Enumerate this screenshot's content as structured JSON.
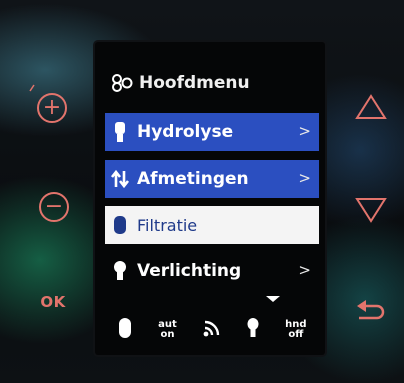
{
  "hardware": {
    "plus_label": "+",
    "minus_label": "−",
    "ok_label": "OK",
    "up_icon": "triangle-up-icon",
    "down_icon": "triangle-down-icon",
    "back_icon": "back-arrow-icon",
    "accent_color": "#e2746c"
  },
  "menu": {
    "title": "Hoofdmenu",
    "title_icon": "menu-glyph-icon",
    "items": [
      {
        "label": "Hydrolyse",
        "icon": "hydrolysis-cell-icon",
        "style": "blue",
        "chevron": ">"
      },
      {
        "label": "Afmetingen",
        "icon": "measurements-arrows-icon",
        "style": "blue",
        "chevron": ">"
      },
      {
        "label": "Filtratie",
        "icon": "filter-icon",
        "style": "selected",
        "chevron": ""
      },
      {
        "label": "Verlichting",
        "icon": "light-icon",
        "style": "dark",
        "chevron": ">"
      }
    ],
    "highlight_color": "#2b4fc0"
  },
  "status_bar": {
    "filter_icon": "filter-status-icon",
    "auto_line1": "aut",
    "auto_line2": "on",
    "wifi_icon": "wifi-icon",
    "light_icon": "light-status-icon",
    "hand_line1": "hnd",
    "hand_line2": "off"
  }
}
